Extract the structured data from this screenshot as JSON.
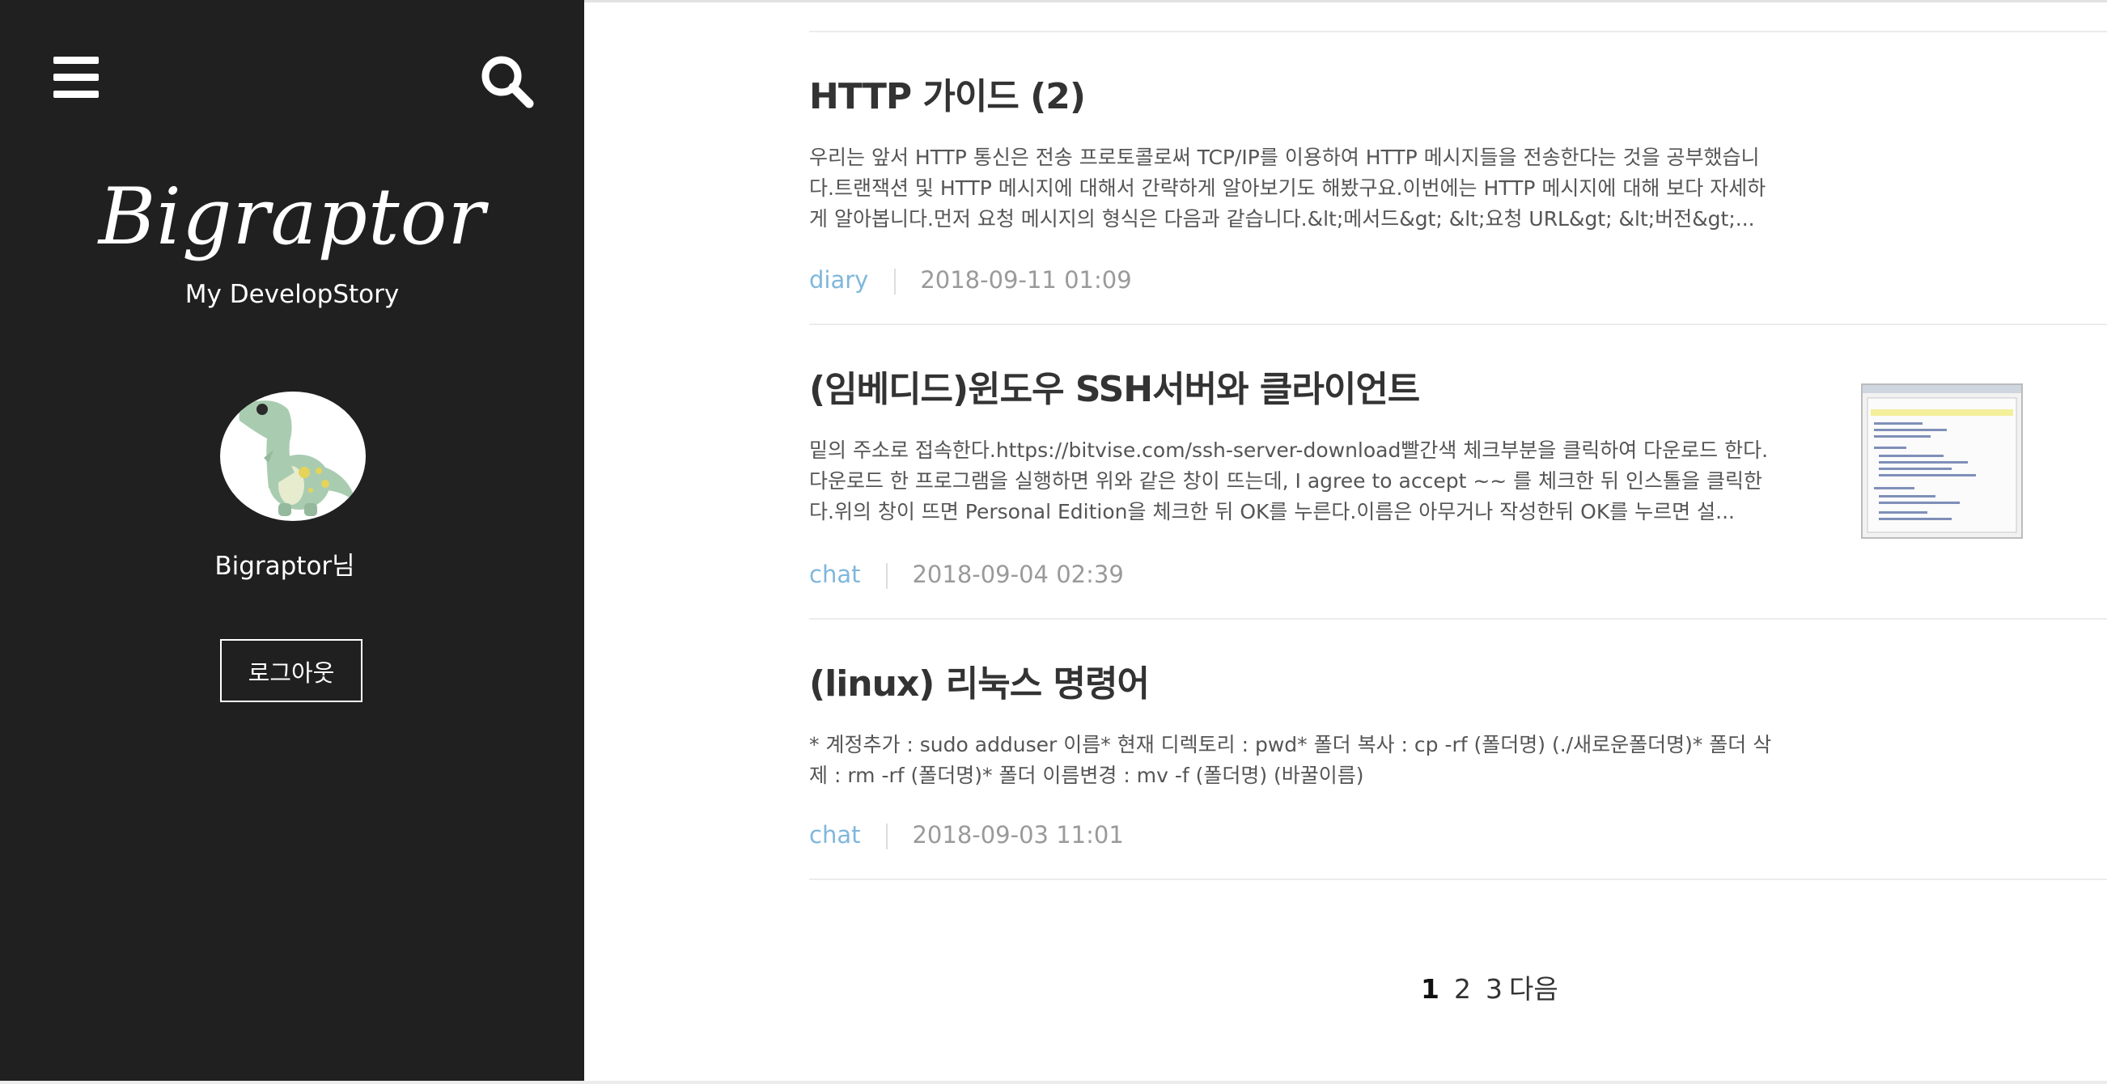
{
  "sidebar": {
    "menu_icon": "hamburger-menu-icon",
    "search_icon": "search-icon",
    "blog_title": "Bigraptor",
    "blog_description": "My DevelopStory",
    "avatar_icon": "dinosaur-avatar",
    "username": "Bigraptor님",
    "logout_label": "로그아웃"
  },
  "posts": [
    {
      "title": "HTTP 가이드 (2)",
      "summary": "우리는 앞서 HTTP 통신은 전송 프로토콜로써 TCP/IP를 이용하여 HTTP 메시지들을 전송한다는 것을 공부했습니다.트랜잭션 및 HTTP 메시지에 대해서 간략하게 알아보기도 해봤구요.이번에는 HTTP 메시지에 대해 보다 자세하게 알아봅니다.먼저 요청 메시지의 형식은 다음과 같습니다.&lt;메서드&gt; &lt;요청 URL&gt; &lt;버전&gt;...",
      "category": "diary",
      "date": "2018-09-11 01:09"
    },
    {
      "title": "(임베디드)윈도우 SSH서버와 클라이언트",
      "summary": "밑의 주소로 접속한다.https://bitvise.com/ssh-server-download빨간색 체크부분을 클릭하여 다운로드 한다.다운로드 한 프로그램을 실행하면 위와 같은 창이 뜨는데, I agree to accept ~~ 를 체크한 뒤 인스톨을 클릭한다.위의 창이 뜨면 Personal Edition을 체크한 뒤 OK를 누른다.이름은 아무거나 작성한뒤 OK를 누르면 설...",
      "category": "chat",
      "date": "2018-09-04 02:39"
    },
    {
      "title": "(linux) 리눅스 명령어",
      "summary": "* 계정추가 : sudo adduser 이름* 현재 디렉토리 : pwd* 폴더 복사 : cp -rf (폴더명) (./새로운폴더명)* 폴더 삭제 : rm -rf (폴더명)* 폴더 이름변경 : mv -f (폴더명) (바꿀이름)",
      "category": "chat",
      "date": "2018-09-03 11:01"
    }
  ],
  "pagination": {
    "pages": [
      "1",
      "2",
      "3"
    ],
    "current": "1",
    "next_label": "다음"
  },
  "colors": {
    "sidebar_bg": "#202020",
    "category": "#7fb7dc",
    "date": "#9a9a9a",
    "title": "#333333"
  }
}
